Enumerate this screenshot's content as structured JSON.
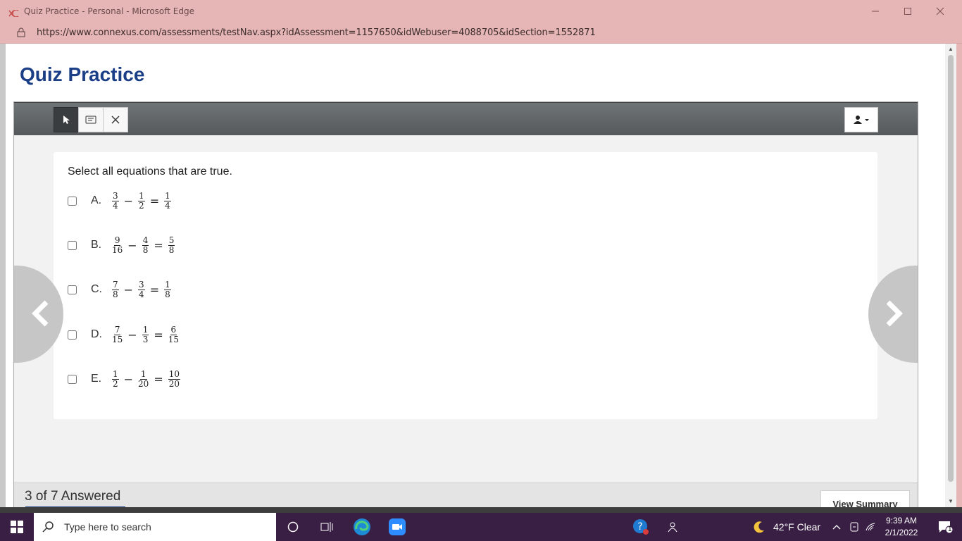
{
  "browser": {
    "window_title": "Quiz Practice - Personal - Microsoft Edge",
    "url": "https://www.connexus.com/assessments/testNav.aspx?idAssessment=1157650&idWebuser=4088705&idSection=1552871"
  },
  "page": {
    "title": "Quiz Practice"
  },
  "question": {
    "prompt": "Select all equations that are true.",
    "choices": [
      {
        "letter": "A.",
        "lhs1": {
          "num": "3",
          "den": "4"
        },
        "op": "−",
        "lhs2": {
          "num": "1",
          "den": "2"
        },
        "eq": "=",
        "rhs": {
          "num": "1",
          "den": "4"
        },
        "checked": false
      },
      {
        "letter": "B.",
        "lhs1": {
          "num": "9",
          "den": "16"
        },
        "op": "−",
        "lhs2": {
          "num": "4",
          "den": "8"
        },
        "eq": "=",
        "rhs": {
          "num": "5",
          "den": "8"
        },
        "checked": false
      },
      {
        "letter": "C.",
        "lhs1": {
          "num": "7",
          "den": "8"
        },
        "op": "−",
        "lhs2": {
          "num": "3",
          "den": "4"
        },
        "eq": "=",
        "rhs": {
          "num": "1",
          "den": "8"
        },
        "checked": false
      },
      {
        "letter": "D.",
        "lhs1": {
          "num": "7",
          "den": "15"
        },
        "op": "−",
        "lhs2": {
          "num": "1",
          "den": "3"
        },
        "eq": "=",
        "rhs": {
          "num": "6",
          "den": "15"
        },
        "checked": false
      },
      {
        "letter": "E.",
        "lhs1": {
          "num": "1",
          "den": "2"
        },
        "op": "−",
        "lhs2": {
          "num": "1",
          "den": "20"
        },
        "eq": "=",
        "rhs": {
          "num": "10",
          "den": "20"
        },
        "checked": false
      }
    ]
  },
  "footer": {
    "answered_text": "3 of 7 Answered",
    "view_summary_label": "View Summary"
  },
  "taskbar": {
    "search_placeholder": "Type here to search",
    "weather": "42°F  Clear",
    "time": "9:39 AM",
    "date": "2/1/2022",
    "notification_count": "1"
  },
  "colors": {
    "brand_blue": "#1b3f86",
    "titlebar": "#e6b6b6",
    "taskbar": "#3a1f45"
  }
}
